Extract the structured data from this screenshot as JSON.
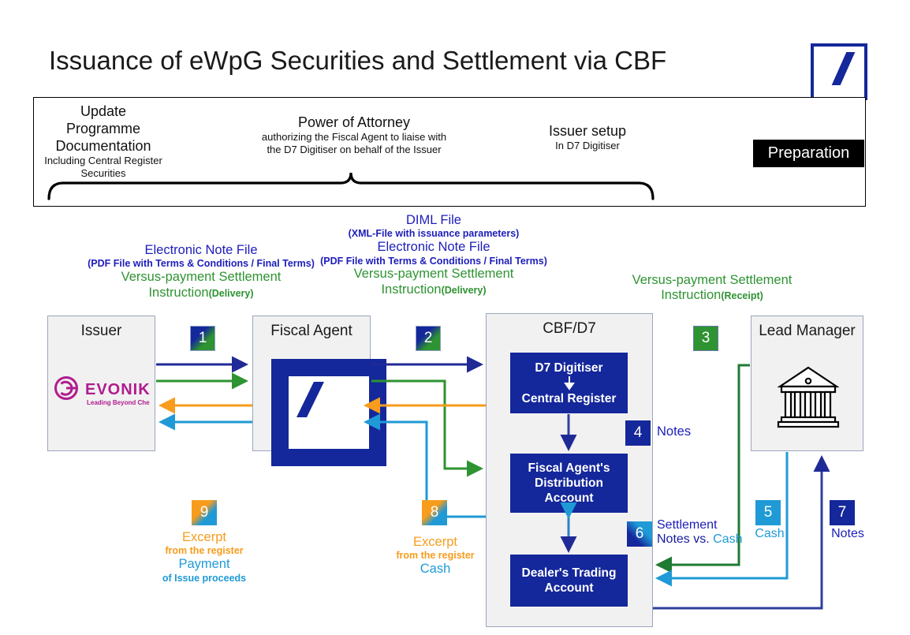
{
  "title": "Issuance of eWpG Securities and Settlement via CBF",
  "brand": {
    "db_logo_name": "deutsche-bank-logo",
    "accent_blue": "#14279b",
    "accent_green": "#2e9331",
    "accent_orange": "#f79c1c",
    "accent_light_blue": "#1f9ad6",
    "evonik_magenta": "#b01c8e"
  },
  "preparation": {
    "badge_label": "Preparation",
    "columns": [
      {
        "main": [
          "Update",
          "Programme",
          "Documentation"
        ],
        "sub": [
          "Including Central Register",
          "Securities"
        ]
      },
      {
        "main": [
          "Power of Attorney"
        ],
        "sub": [
          "authorizing the Fiscal Agent to liaise with",
          "the D7 Digitiser on behalf of the Issuer"
        ]
      },
      {
        "main": [
          "Issuer setup"
        ],
        "sub": [
          "In D7 Digitiser"
        ]
      }
    ]
  },
  "flow_labels": {
    "left": {
      "blue_lines": [
        "Electronic Note File",
        "(PDF File with Terms & Conditions / Final Terms)"
      ],
      "green_line_1": "Versus-payment Settlement",
      "green_line_2": "Instruction",
      "green_line_2_sub": "(Delivery)"
    },
    "middle": {
      "blue_lines": [
        "DIML File",
        "(XML-File with issuance parameters)",
        "Electronic Note File",
        "(PDF File with Terms & Conditions / Final Terms)"
      ],
      "green_line_1": "Versus-payment Settlement",
      "green_line_2": "Instruction",
      "green_line_2_sub": "(Delivery)"
    },
    "right": {
      "green_line_1": "Versus-payment Settlement",
      "green_line_2": "Instruction",
      "green_line_2_sub": "(Receipt)"
    }
  },
  "entities": {
    "issuer": {
      "title": "Issuer",
      "logo": "evonik-logo",
      "logo_text": "EVONIK",
      "logo_tagline": "Leading Beyond Chemistry"
    },
    "fiscal_agent": {
      "title": "Fiscal Agent",
      "logo": "deutsche-bank-logo"
    },
    "cbf": {
      "title": "CBF/D7",
      "accounts": [
        {
          "name": "d7-digitiser-central-register",
          "lines": [
            "D7 Digitiser",
            "Central Register"
          ]
        },
        {
          "name": "fiscal-agents-distribution-account",
          "lines": [
            "Fiscal Agent's",
            "Distribution",
            "Account"
          ]
        },
        {
          "name": "dealers-trading-account",
          "lines": [
            "Dealer's Trading",
            "Account"
          ]
        }
      ]
    },
    "lead_manager": {
      "title": "Lead Manager",
      "logo": "bank-building-icon"
    }
  },
  "steps": [
    {
      "number": "1",
      "style": "bluegreen"
    },
    {
      "number": "2",
      "style": "bluegreen"
    },
    {
      "number": "3",
      "style": "green"
    },
    {
      "number": "4",
      "style": "dkblue",
      "label": "Notes"
    },
    {
      "number": "5",
      "style": "ltblue",
      "label": "Cash"
    },
    {
      "number": "6",
      "style": "ltblue-grad",
      "label_main": "Settlement",
      "label_sub_a": "Notes vs.",
      "label_sub_b": "Cash"
    },
    {
      "number": "7",
      "style": "dkblue",
      "label": "Notes"
    },
    {
      "number": "8",
      "style": "orangeblue",
      "label_orange_main": "Excerpt",
      "label_orange_sub": "from the register",
      "label_blue_main": "Cash"
    },
    {
      "number": "9",
      "style": "orangeblue",
      "label_orange_main": "Excerpt",
      "label_orange_sub": "from the register",
      "label_blue_main": "Payment",
      "label_blue_sub": "of Issue proceeds"
    }
  ]
}
